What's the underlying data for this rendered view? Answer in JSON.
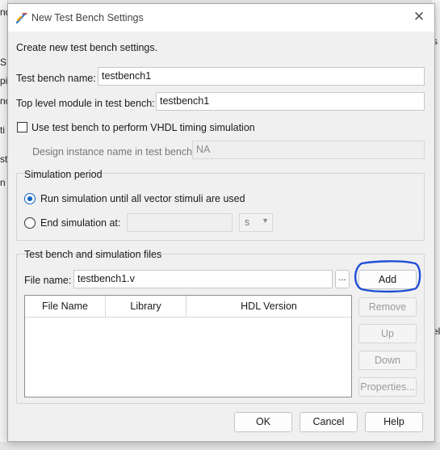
{
  "background": {
    "left_fragments": [
      "nd",
      "S",
      "pi",
      "nc",
      "ti",
      "st",
      "n"
    ],
    "right_fragments": [
      "s",
      "el"
    ]
  },
  "dialog": {
    "title": "New Test Bench Settings",
    "intro": "Create new test bench settings.",
    "test_bench_name_label": "Test bench name:",
    "test_bench_name_value": "testbench1",
    "top_level_module_label": "Top level module in test bench:",
    "top_level_module_value": "testbench1",
    "vhdl_timing_label": "Use test bench to perform VHDL timing simulation",
    "vhdl_timing_checked": false,
    "design_instance_label": "Design instance name in test bench:",
    "design_instance_value": "NA",
    "simulation_period": {
      "title": "Simulation period",
      "run_until_label": "Run simulation until all vector stimuli are used",
      "end_at_label": "End simulation at:",
      "end_value": "",
      "unit": "s",
      "selected": "run_until"
    },
    "files": {
      "title": "Test bench and simulation files",
      "file_name_label": "File name:",
      "file_name_value": "testbench1.v",
      "browse_label": "...",
      "columns": [
        "File Name",
        "Library",
        "HDL Version"
      ],
      "rows": [],
      "add_label": "Add",
      "remove_label": "Remove",
      "up_label": "Up",
      "down_label": "Down",
      "properties_label": "Properties..."
    },
    "ok_label": "OK",
    "cancel_label": "Cancel",
    "help_label": "Help",
    "close_glyph": "✕"
  },
  "colors": {
    "accent": "#0b62c4",
    "annotation": "#1f4fd6"
  }
}
